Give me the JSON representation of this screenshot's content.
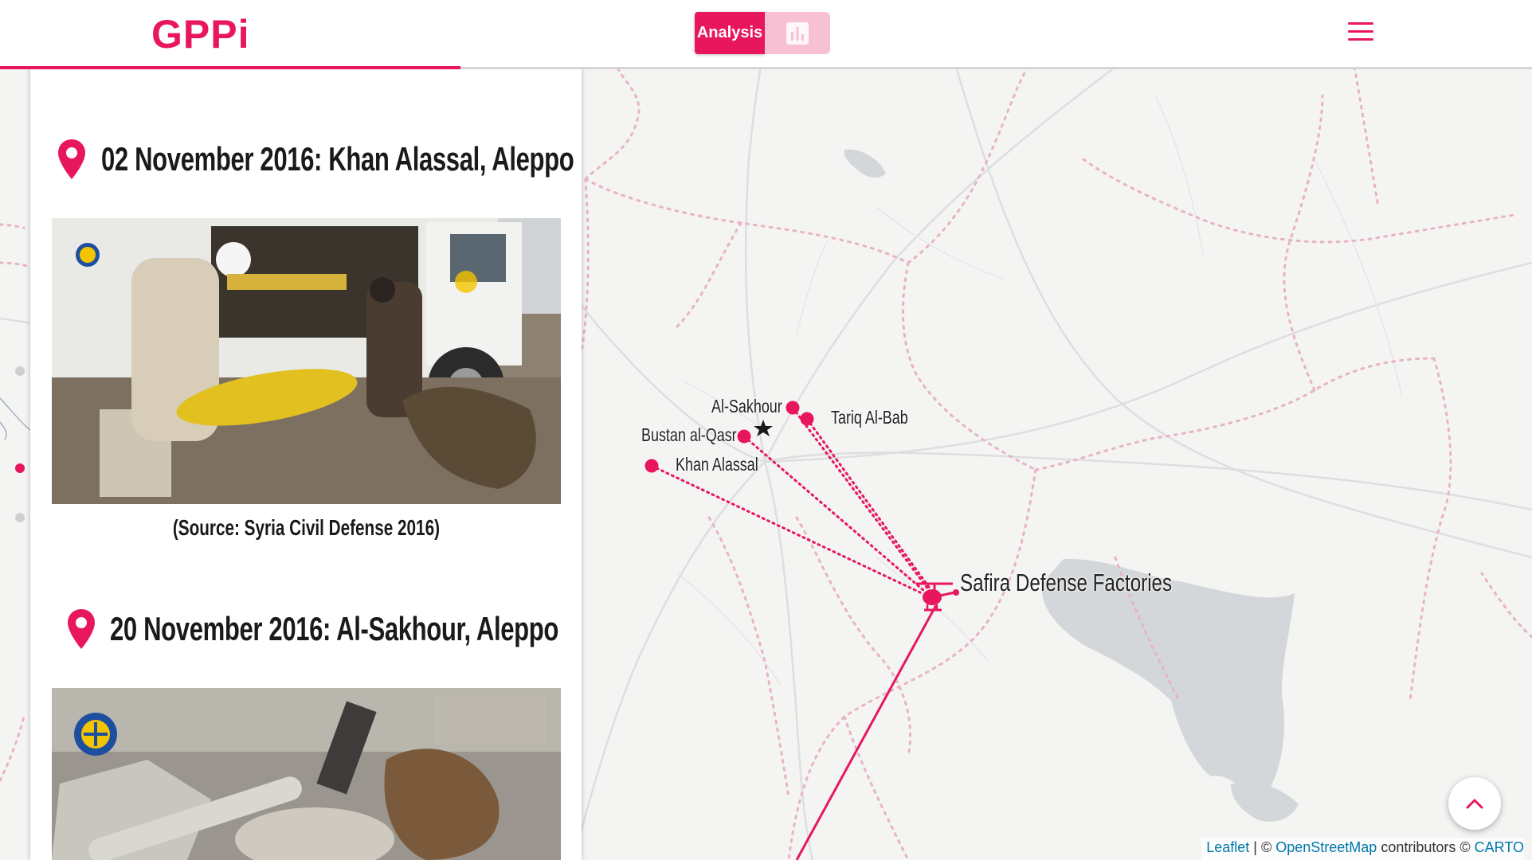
{
  "header": {
    "logo": "GPPi",
    "toggle_analysis_label": "Analysis",
    "toggle_chart_icon": "bar-chart-icon",
    "menu_icon": "hamburger-menu-icon"
  },
  "panel": {
    "events": [
      {
        "title": "02 November 2016: Khan Alassal, Aleppo",
        "caption": "(Source: Syria Civil Defense 2016)"
      },
      {
        "title": "20 November 2016: Al-Sakhour, Aleppo"
      }
    ]
  },
  "map": {
    "origin_label": "Safira Defense Factories",
    "targets": [
      {
        "name": "Al-Sakhour"
      },
      {
        "name": "Tariq Al-Bab"
      },
      {
        "name": "Bustan al-Qasr"
      },
      {
        "name": "Khan Alassal"
      }
    ]
  },
  "attribution": {
    "leaflet": "Leaflet",
    "sep1": " | © ",
    "osm": "OpenStreetMap",
    "mid": " contributors © ",
    "carto": "CARTO"
  },
  "colors": {
    "accent": "#e8175d",
    "accent_light": "#f7c1d3",
    "map_background": "#f4f4f2",
    "water": "#d2d6d8",
    "border_dashed": "#e7b4c3"
  }
}
